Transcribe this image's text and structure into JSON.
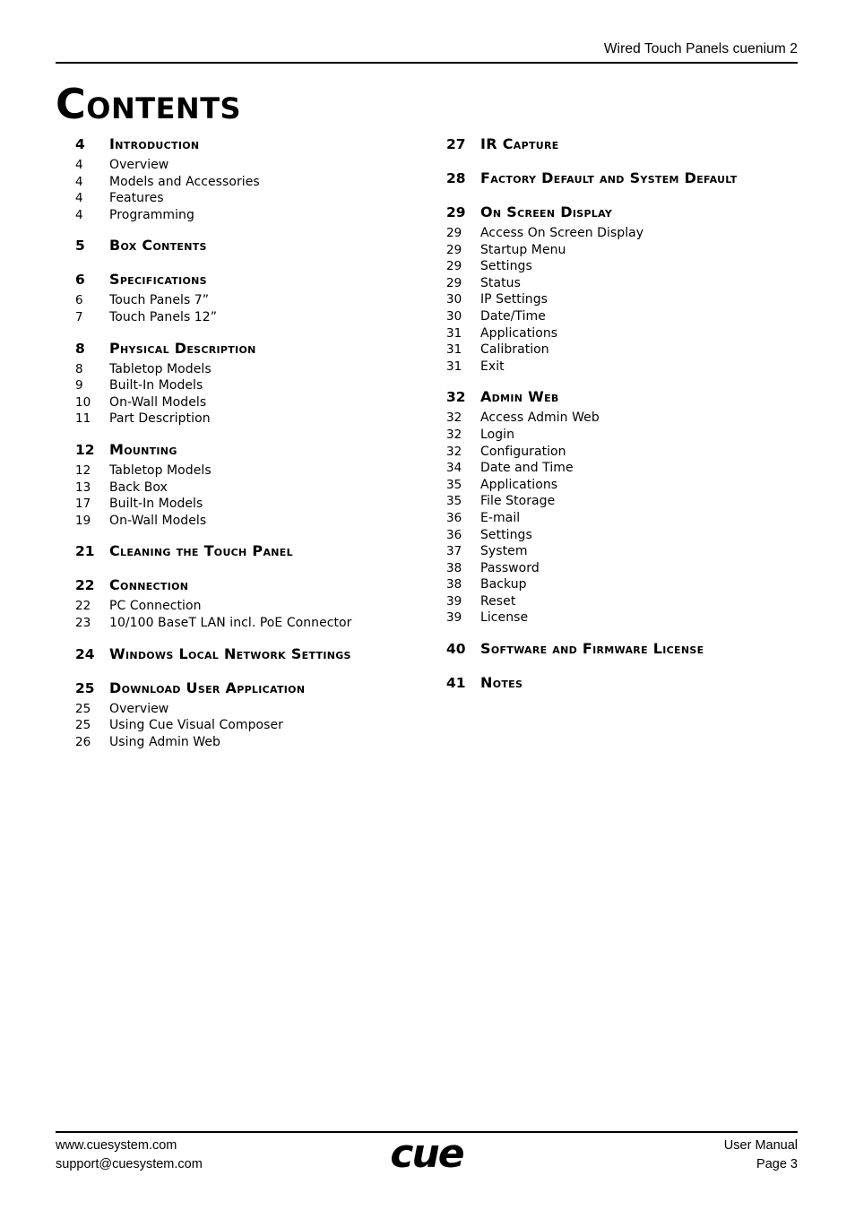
{
  "header": {
    "running_title": "Wired Touch Panels cuenium 2"
  },
  "page_title": "Contents",
  "toc": {
    "left_column": [
      {
        "section": {
          "page": "4",
          "title": "Introduction"
        },
        "entries": [
          {
            "page": "4",
            "title": "Overview"
          },
          {
            "page": "4",
            "title": "Models and Accessories"
          },
          {
            "page": "4",
            "title": "Features"
          },
          {
            "page": "4",
            "title": "Programming"
          }
        ]
      },
      {
        "section": {
          "page": "5",
          "title": "Box Contents"
        },
        "entries": []
      },
      {
        "section": {
          "page": "6",
          "title": "Specifications"
        },
        "entries": [
          {
            "page": "6",
            "title": "Touch Panels 7”"
          },
          {
            "page": "7",
            "title": "Touch Panels 12”"
          }
        ]
      },
      {
        "section": {
          "page": "8",
          "title": "Physical Description"
        },
        "entries": [
          {
            "page": "8",
            "title": "Tabletop Models"
          },
          {
            "page": "9",
            "title": "Built-In Models"
          },
          {
            "page": "10",
            "title": "On-Wall Models"
          },
          {
            "page": "11",
            "title": "Part Description"
          }
        ]
      },
      {
        "section": {
          "page": "12",
          "title": "Mounting"
        },
        "entries": [
          {
            "page": "12",
            "title": "Tabletop Models"
          },
          {
            "page": "13",
            "title": "Back Box"
          },
          {
            "page": "17",
            "title": "Built-In Models"
          },
          {
            "page": "19",
            "title": "On-Wall Models"
          }
        ]
      },
      {
        "section": {
          "page": "21",
          "title": "Cleaning the Touch Panel"
        },
        "entries": []
      },
      {
        "section": {
          "page": "22",
          "title": "Connection"
        },
        "entries": [
          {
            "page": "22",
            "title": "PC Connection"
          },
          {
            "page": "23",
            "title": "10/100 BaseT LAN incl. PoE Connector"
          }
        ]
      },
      {
        "section": {
          "page": "24",
          "title": "Windows Local Network Settings"
        },
        "entries": []
      },
      {
        "section": {
          "page": "25",
          "title": "Download User Application"
        },
        "entries": [
          {
            "page": "25",
            "title": "Overview"
          },
          {
            "page": "25",
            "title": "Using Cue Visual Composer"
          },
          {
            "page": "26",
            "title": "Using Admin Web"
          }
        ]
      }
    ],
    "right_column": [
      {
        "section": {
          "page": "27",
          "title": "IR Capture"
        },
        "entries": []
      },
      {
        "section": {
          "page": "28",
          "title": "Factory Default and System Default"
        },
        "entries": []
      },
      {
        "section": {
          "page": "29",
          "title": "On Screen Display"
        },
        "entries": [
          {
            "page": "29",
            "title": "Access On Screen Display"
          },
          {
            "page": "29",
            "title": "Startup Menu"
          },
          {
            "page": "29",
            "title": "Settings"
          },
          {
            "page": "29",
            "title": "Status"
          },
          {
            "page": "30",
            "title": "IP Settings"
          },
          {
            "page": "30",
            "title": "Date/Time"
          },
          {
            "page": "31",
            "title": "Applications"
          },
          {
            "page": "31",
            "title": "Calibration"
          },
          {
            "page": "31",
            "title": "Exit"
          }
        ]
      },
      {
        "section": {
          "page": "32",
          "title": "Admin Web"
        },
        "entries": [
          {
            "page": "32",
            "title": "Access Admin Web"
          },
          {
            "page": "32",
            "title": "Login"
          },
          {
            "page": "32",
            "title": "Configuration"
          },
          {
            "page": "34",
            "title": "Date and Time"
          },
          {
            "page": "35",
            "title": "Applications"
          },
          {
            "page": "35",
            "title": "File Storage"
          },
          {
            "page": "36",
            "title": "E-mail"
          },
          {
            "page": "36",
            "title": "Settings"
          },
          {
            "page": "37",
            "title": "System"
          },
          {
            "page": "38",
            "title": "Password"
          },
          {
            "page": "38",
            "title": "Backup"
          },
          {
            "page": "39",
            "title": "Reset"
          },
          {
            "page": "39",
            "title": "License"
          }
        ]
      },
      {
        "section": {
          "page": "40",
          "title": "Software and Firmware License"
        },
        "entries": []
      },
      {
        "section": {
          "page": "41",
          "title": "Notes"
        },
        "entries": []
      }
    ]
  },
  "footer": {
    "website": "www.cuesystem.com",
    "email": "support@cuesystem.com",
    "logo_text": "cue",
    "document_type": "User Manual",
    "page_label": "Page 3"
  }
}
